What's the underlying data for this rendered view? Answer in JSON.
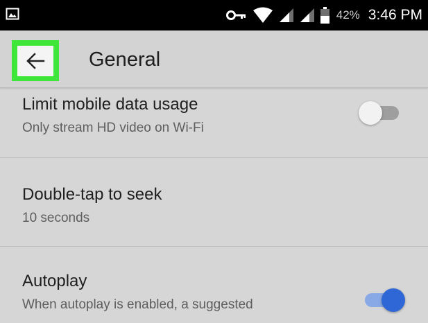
{
  "status_bar": {
    "battery_percent": "42%",
    "time": "3:46 PM",
    "icons": [
      "image-notification-icon",
      "vpn-key-icon",
      "wifi-icon",
      "cell-signal-icon",
      "cell-signal-icon",
      "battery-icon"
    ]
  },
  "app_bar": {
    "title": "General",
    "back_icon": "arrow-left-icon",
    "highlight_color": "#3fe63a"
  },
  "settings": [
    {
      "title": "Limit mobile data usage",
      "subtitle": "Only stream HD video on Wi-Fi",
      "toggle": "off"
    },
    {
      "title": "Double-tap to seek",
      "subtitle": "10 seconds"
    },
    {
      "title": "Autoplay",
      "subtitle": "When autoplay is enabled, a suggested",
      "toggle": "on"
    }
  ],
  "colors": {
    "background": "#d6d6d6",
    "toggle_on": "#2f67d6",
    "toggle_off": "#f2f2f2"
  }
}
